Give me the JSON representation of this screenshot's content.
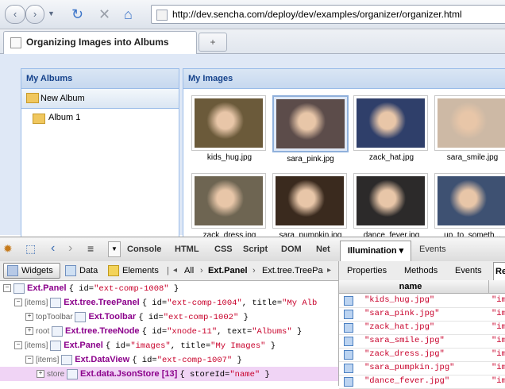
{
  "browser": {
    "back": "‹",
    "forward": "›",
    "url": "http://dev.sencha.com/deploy/dev/examples/organizer/organizer.html",
    "tab_title": "Organizing Images into Albums",
    "newtab": "+"
  },
  "albums": {
    "title": "My Albums",
    "new_album": "New Album",
    "album1": "Album 1"
  },
  "images": {
    "title": "My Images",
    "items": [
      {
        "name": "kids_hug.jpg",
        "color": "#6b5a3a"
      },
      {
        "name": "sara_pink.jpg",
        "color": "#5c4c4a"
      },
      {
        "name": "zack_hat.jpg",
        "color": "#2f3f6a"
      },
      {
        "name": "sara_smile.jpg",
        "color": "#cdb9a5"
      },
      {
        "name": "zack_dress.jpg",
        "color": "#6e6552"
      },
      {
        "name": "sara_pumpkin.jpg",
        "color": "#3a2a1e"
      },
      {
        "name": "dance_fever.jpg",
        "color": "#2c2a2a"
      },
      {
        "name": "up_to_someth...",
        "color": "#3e5172"
      }
    ]
  },
  "firebug": {
    "tabs": [
      "Console",
      "HTML",
      "CSS",
      "Script",
      "DOM",
      "Net"
    ],
    "illumination": "Illumination ▾",
    "events_tab": "Events",
    "widgets": "Widgets",
    "data": "Data",
    "elements": "Elements",
    "crumb_all": "All",
    "crumb_panel": "Ext.Panel",
    "crumb_tree": "Ext.tree.TreePa",
    "right_tabs": [
      "Properties",
      "Methods",
      "Events",
      "Re"
    ],
    "grid_header": "name",
    "grid_rows": [
      "\"kids_hug.jpg\"",
      "\"sara_pink.jpg\"",
      "\"zack_hat.jpg\"",
      "\"sara_smile.jpg\"",
      "\"zack_dress.jpg\"",
      "\"sara_pumpkin.jpg\"",
      "\"dance_fever.jpg\""
    ],
    "grid_trunc": "\"im",
    "tree": [
      {
        "key": "",
        "cls": "Ext.Panel",
        "rest": "{ id=\"ext-comp-1008\" }"
      },
      {
        "key": "[items]",
        "cls": "Ext.tree.TreePanel",
        "rest": "{ id=\"ext-comp-1004\",  title=\"My Alb"
      },
      {
        "key": "topToolbar",
        "cls": "Ext.Toolbar",
        "rest": "{ id=\"ext-comp-1002\" }"
      },
      {
        "key": "root",
        "cls": "Ext.tree.TreeNode",
        "rest": "{ id=\"xnode-11\",  text=\"Albums\" }"
      },
      {
        "key": "[items]",
        "cls": "Ext.Panel",
        "rest": "{ id=\"images\",  title=\"My Images\" }"
      },
      {
        "key": "[items]",
        "cls": "Ext.DataView",
        "rest": "{ id=\"ext-comp-1007\" }"
      },
      {
        "key": "store",
        "cls": "Ext.data.JsonStore [13]",
        "rest": "{ storeId=\"name\" }"
      }
    ]
  }
}
